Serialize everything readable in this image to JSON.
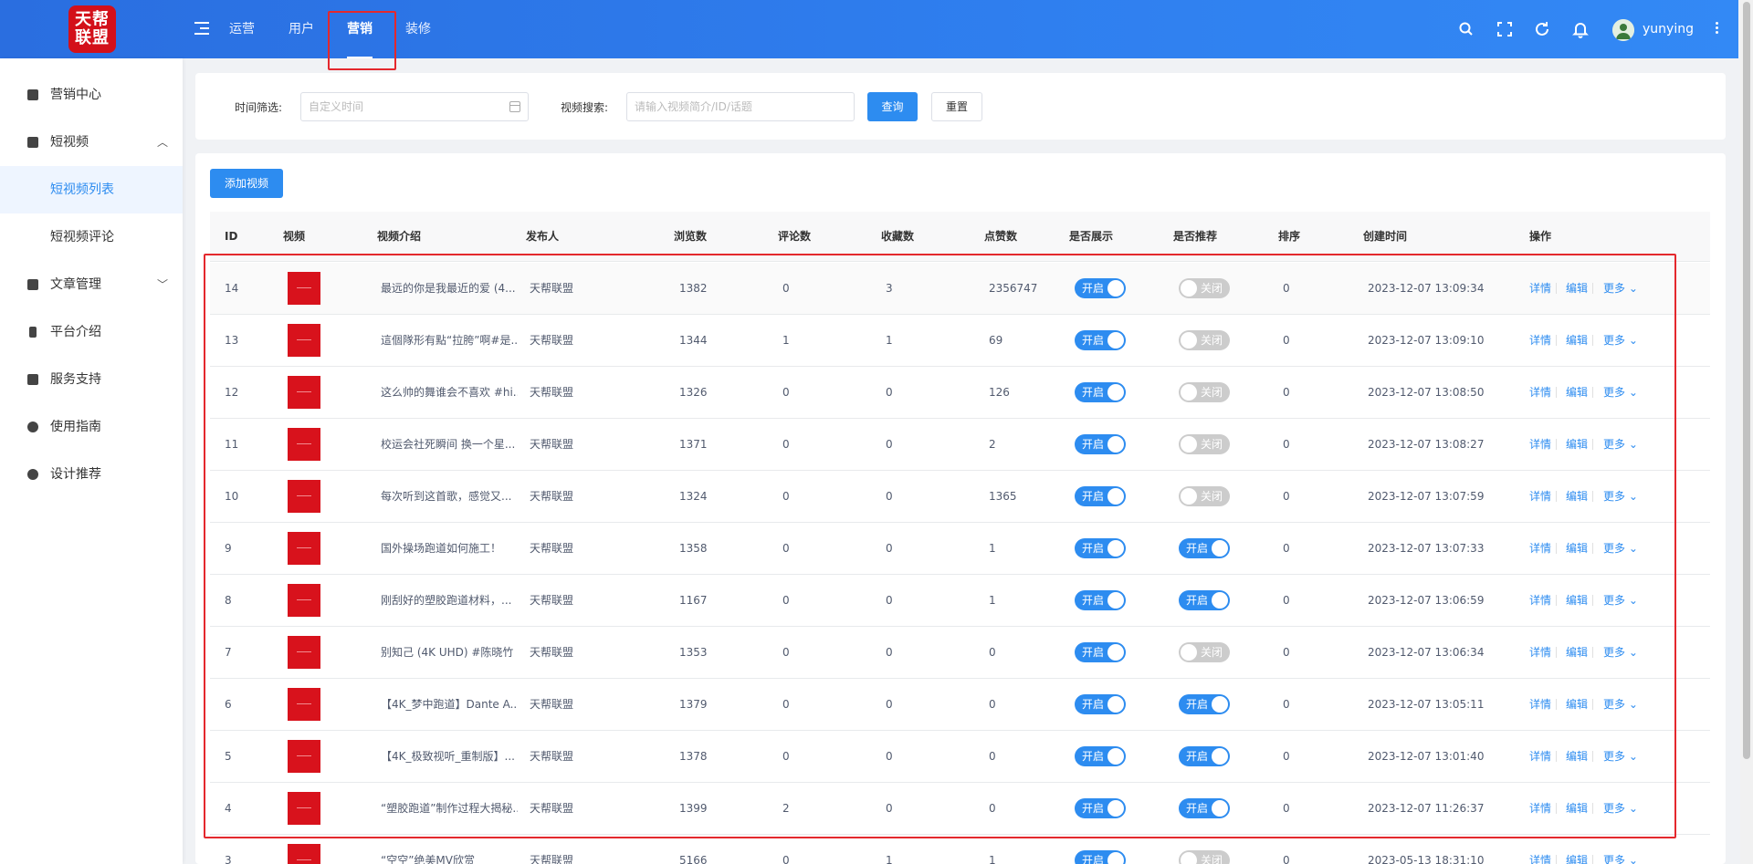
{
  "header": {
    "logo_text_line1": "天帮",
    "logo_text_line2": "联盟",
    "nav": [
      "运营",
      "用户",
      "营销",
      "装修"
    ],
    "active_nav": "营销",
    "username": "yunying"
  },
  "sidebar": {
    "items": [
      {
        "label": "营销中心"
      },
      {
        "label": "短视频",
        "expanded": true
      },
      {
        "label": "短视频列表",
        "sub": true,
        "active": true
      },
      {
        "label": "短视频评论",
        "sub": true
      },
      {
        "label": "文章管理"
      },
      {
        "label": "平台介绍"
      },
      {
        "label": "服务支持"
      },
      {
        "label": "使用指南"
      },
      {
        "label": "设计推荐"
      }
    ]
  },
  "search": {
    "time_label": "时间筛选:",
    "time_placeholder": "自定义时间",
    "video_label": "视频搜索:",
    "video_placeholder": "请输入视频简介/ID/话题",
    "query_button": "查询",
    "reset_button": "重置"
  },
  "toolbar": {
    "add_button": "添加视频"
  },
  "table": {
    "columns": [
      "ID",
      "视频",
      "视频介绍",
      "发布人",
      "浏览数",
      "评论数",
      "收藏数",
      "点赞数",
      "是否展示",
      "是否推荐",
      "排序",
      "创建时间",
      "操作"
    ],
    "switch_on": "开启",
    "switch_off": "关闭",
    "actions": {
      "detail": "详情",
      "edit": "编辑",
      "more": "更多 ⌄"
    },
    "rows": [
      {
        "id": "14",
        "intro": "最远的你是我最近的爱 (4...",
        "publisher": "天帮联盟",
        "views": "1382",
        "comments": "0",
        "favorites": "3",
        "likes": "2356747",
        "show": true,
        "recommend": false,
        "sort": "0",
        "created": "2023-12-07 13:09:34"
      },
      {
        "id": "13",
        "intro": "這個隊形有點“拉胯”啊#是...",
        "publisher": "天帮联盟",
        "views": "1344",
        "comments": "1",
        "favorites": "1",
        "likes": "69",
        "show": true,
        "recommend": false,
        "sort": "0",
        "created": "2023-12-07 13:09:10"
      },
      {
        "id": "12",
        "intro": "这么帅的舞谁会不喜欢 #hi...",
        "publisher": "天帮联盟",
        "views": "1326",
        "comments": "0",
        "favorites": "0",
        "likes": "126",
        "show": true,
        "recommend": false,
        "sort": "0",
        "created": "2023-12-07 13:08:50"
      },
      {
        "id": "11",
        "intro": "校运会社死瞬间 换一个星...",
        "publisher": "天帮联盟",
        "views": "1371",
        "comments": "0",
        "favorites": "0",
        "likes": "2",
        "show": true,
        "recommend": false,
        "sort": "0",
        "created": "2023-12-07 13:08:27"
      },
      {
        "id": "10",
        "intro": "每次听到这首歌，感觉又...",
        "publisher": "天帮联盟",
        "views": "1324",
        "comments": "0",
        "favorites": "0",
        "likes": "1365",
        "show": true,
        "recommend": false,
        "sort": "0",
        "created": "2023-12-07 13:07:59"
      },
      {
        "id": "9",
        "intro": "国外操场跑道如何施工！",
        "publisher": "天帮联盟",
        "views": "1358",
        "comments": "0",
        "favorites": "0",
        "likes": "1",
        "show": true,
        "recommend": true,
        "sort": "0",
        "created": "2023-12-07 13:07:33"
      },
      {
        "id": "8",
        "intro": "刚刮好的塑胶跑道材料，...",
        "publisher": "天帮联盟",
        "views": "1167",
        "comments": "0",
        "favorites": "0",
        "likes": "1",
        "show": true,
        "recommend": true,
        "sort": "0",
        "created": "2023-12-07 13:06:59"
      },
      {
        "id": "7",
        "intro": "别知己 (4K UHD) #陈晓竹 ...",
        "publisher": "天帮联盟",
        "views": "1353",
        "comments": "0",
        "favorites": "0",
        "likes": "0",
        "show": true,
        "recommend": false,
        "sort": "0",
        "created": "2023-12-07 13:06:34"
      },
      {
        "id": "6",
        "intro": "【4K_梦中跑道】Dante A...",
        "publisher": "天帮联盟",
        "views": "1379",
        "comments": "0",
        "favorites": "0",
        "likes": "0",
        "show": true,
        "recommend": true,
        "sort": "0",
        "created": "2023-12-07 13:05:11"
      },
      {
        "id": "5",
        "intro": "【4K_极致视听_重制版】...",
        "publisher": "天帮联盟",
        "views": "1378",
        "comments": "0",
        "favorites": "0",
        "likes": "0",
        "show": true,
        "recommend": true,
        "sort": "0",
        "created": "2023-12-07 13:01:40"
      },
      {
        "id": "4",
        "intro": "“塑胶跑道”制作过程大揭秘...",
        "publisher": "天帮联盟",
        "views": "1399",
        "comments": "2",
        "favorites": "0",
        "likes": "0",
        "show": true,
        "recommend": true,
        "sort": "0",
        "created": "2023-12-07 11:26:37"
      },
      {
        "id": "3",
        "intro": "“空空”绝美MV欣赏",
        "publisher": "天帮联盟",
        "views": "5166",
        "comments": "0",
        "favorites": "1",
        "likes": "1",
        "show": true,
        "recommend": false,
        "sort": "0",
        "created": "2023-05-13 18:31:10"
      }
    ]
  },
  "colors": {
    "accent": "#2d8cf0",
    "header_blue": "#2f7fef",
    "highlight_red": "#e4282d",
    "thumb_red": "#d8121c"
  }
}
